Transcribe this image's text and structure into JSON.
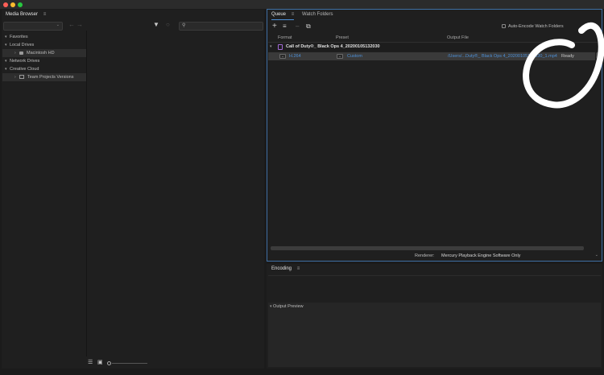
{
  "media_browser": {
    "title": "Media Browser",
    "tree": {
      "favorites": "Favorites",
      "local_drives": "Local Drives",
      "macintosh_hd": "Macintosh HD",
      "network_drives": "Network Drives",
      "creative_cloud": "Creative Cloud",
      "team_projects": "Team Projects Versions"
    }
  },
  "queue": {
    "tabs": [
      "Queue",
      "Watch Folders"
    ],
    "auto_encode_label": "Auto-Encode Watch Folders",
    "columns": {
      "format": "Format",
      "preset": "Preset",
      "output_file": "Output File"
    },
    "job": {
      "name": "Call of Duty®_ Black Ops 4_20200105132030",
      "format": "H.264",
      "preset": "Custom",
      "output": "/Users/...Duty®_ Black Ops 4_20200105132030_1.mp4",
      "status": "Ready"
    },
    "renderer_label": "Renderer:",
    "renderer_value": "Mercury Playback Engine Software Only"
  },
  "encoding": {
    "title": "Encoding",
    "output_preview": "Output Preview"
  },
  "colors": {
    "accent": "#4d8fd6",
    "panel": "#1f1f1f",
    "annotation": "#ffffff"
  }
}
